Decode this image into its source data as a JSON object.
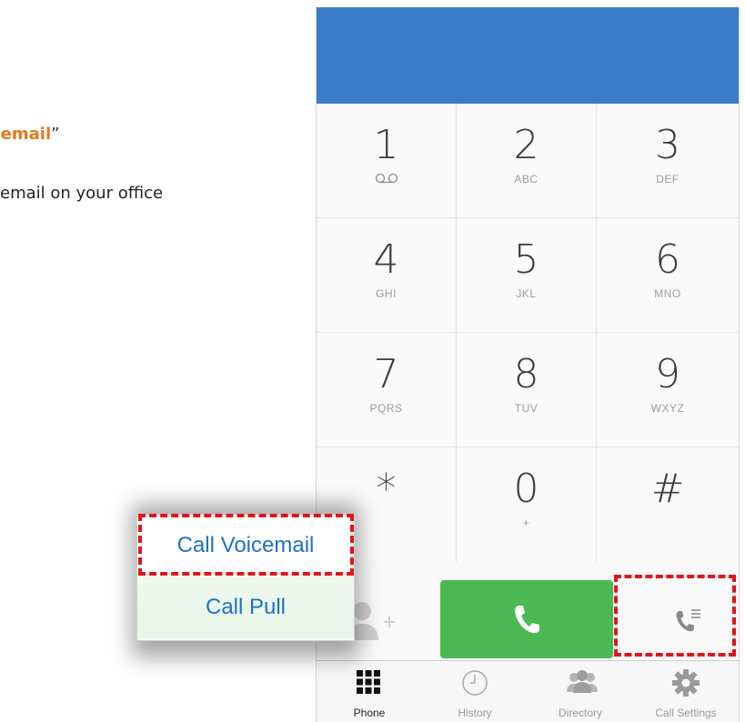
{
  "doc": {
    "line1_highlight": "cemail",
    "line1_quote": "”",
    "line2": "email on your office"
  },
  "keypad": [
    {
      "digit": "1",
      "letters": ""
    },
    {
      "digit": "2",
      "letters": "ABC"
    },
    {
      "digit": "3",
      "letters": "DEF"
    },
    {
      "digit": "4",
      "letters": "GHI"
    },
    {
      "digit": "5",
      "letters": "JKL"
    },
    {
      "digit": "6",
      "letters": "MNO"
    },
    {
      "digit": "7",
      "letters": "PQRS"
    },
    {
      "digit": "8",
      "letters": "TUV"
    },
    {
      "digit": "9",
      "letters": "WXYZ"
    },
    {
      "digit": "*",
      "letters": ""
    },
    {
      "digit": "0",
      "letters": "+"
    },
    {
      "digit": "#",
      "letters": ""
    }
  ],
  "tabs": [
    {
      "label": "Phone",
      "icon": "keypad-grid-icon"
    },
    {
      "label": "History",
      "icon": "clock-icon"
    },
    {
      "label": "Directory",
      "icon": "people-icon"
    },
    {
      "label": "Call Settings",
      "icon": "gear-icon"
    }
  ],
  "popup": {
    "item1": "Call Voicemail",
    "item2": "Call Pull"
  },
  "colors": {
    "header_blue": "#3b7cc9",
    "call_green": "#4cb853",
    "highlight_red": "#e0151b",
    "doc_orange": "#e07a1c",
    "popup_link_blue": "#1f6fc7"
  }
}
